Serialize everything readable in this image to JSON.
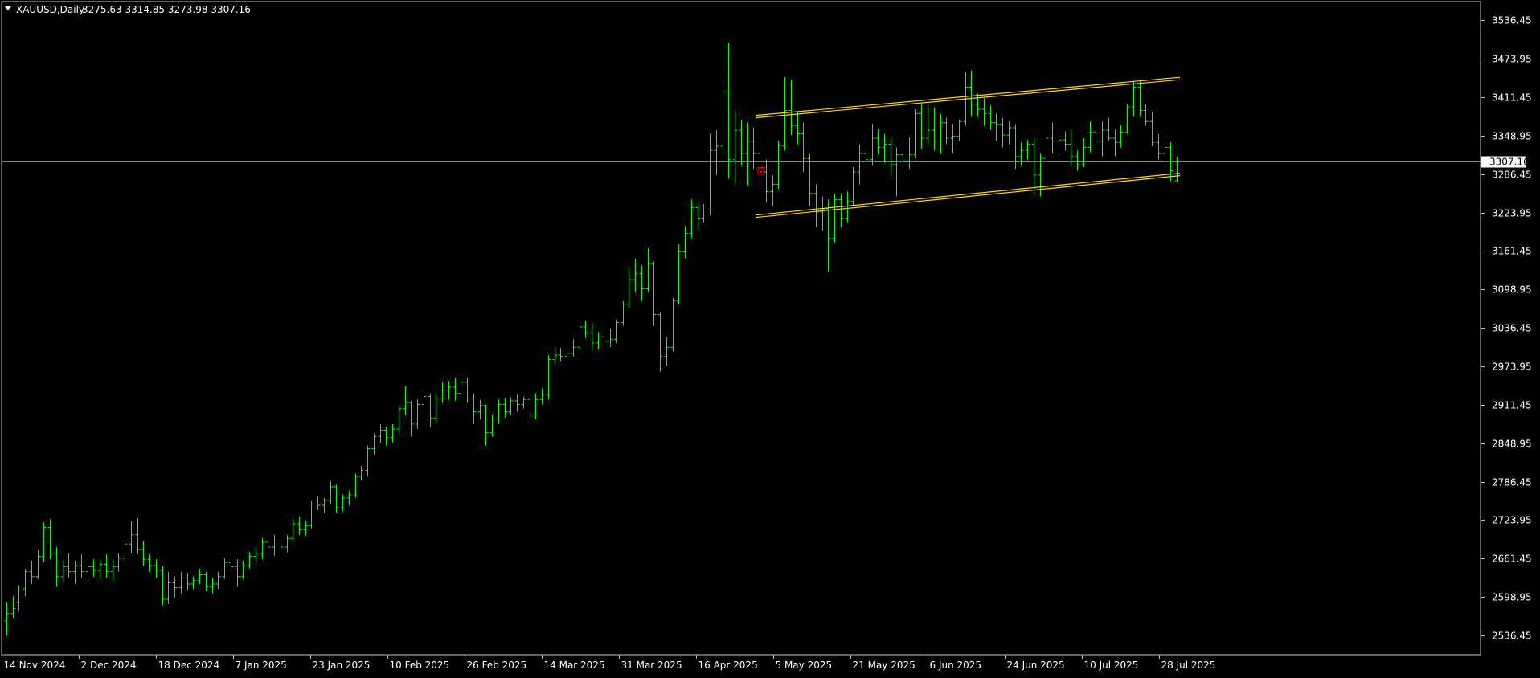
{
  "header": {
    "symbol_label": "XAUUSD,Daily",
    "ohlc_label": "3275.63 3314.85 3273.98 3307.16"
  },
  "colors": {
    "background": "#000000",
    "frame": "#c0c0c0",
    "axis_text": "#ffffff",
    "bar": "#00ff00",
    "channel": "#ffd700",
    "price_line": "#778899",
    "arrow_marker": "#ff0000",
    "price_tag_bg": "#ffffff",
    "price_tag_text": "#000000"
  },
  "icons": {
    "symbol_dropdown": "triangle-down-icon",
    "entry_marker": "arrow-marker-icon"
  },
  "chart_data": {
    "type": "ohlc",
    "title": "XAUUSD,Daily",
    "current_price": 3307.16,
    "current_price_label": "3307.16",
    "ylim": [
      2505.0,
      3567.0
    ],
    "y_ticks": [
      "3536.45",
      "3473.95",
      "3411.45",
      "3348.95",
      "3286.45",
      "3223.95",
      "3161.45",
      "3098.95",
      "3036.45",
      "2973.95",
      "2911.45",
      "2848.95",
      "2786.45",
      "2723.95",
      "2661.45",
      "2598.95",
      "2536.45"
    ],
    "x_ticks": [
      "14 Nov 2024",
      "2 Dec 2024",
      "18 Dec 2024",
      "7 Jan 2025",
      "23 Jan 2025",
      "10 Feb 2025",
      "26 Feb 2025",
      "14 Mar 2025",
      "31 Mar 2025",
      "16 Apr 2025",
      "5 May 2025",
      "21 May 2025",
      "6 Jun 2025",
      "24 Jun 2025",
      "10 Jul 2025",
      "28 Jul 2025"
    ],
    "channel_start": "22 Apr 2025",
    "channel_end": "29 Jul 2025",
    "channel_upper": [
      3380,
      3442
    ],
    "channel_lower": [
      3218,
      3286
    ],
    "marker_price": 3292,
    "bars": [
      {
        "o": 2560,
        "h": 2590,
        "l": 2536,
        "c": 2572
      },
      {
        "o": 2572,
        "h": 2600,
        "l": 2565,
        "c": 2580
      },
      {
        "o": 2590,
        "h": 2618,
        "l": 2575,
        "c": 2610
      },
      {
        "o": 2612,
        "h": 2645,
        "l": 2600,
        "c": 2640
      },
      {
        "o": 2640,
        "h": 2658,
        "l": 2620,
        "c": 2632
      },
      {
        "o": 2632,
        "h": 2675,
        "l": 2628,
        "c": 2665
      },
      {
        "o": 2665,
        "h": 2720,
        "l": 2655,
        "c": 2712
      },
      {
        "o": 2712,
        "h": 2725,
        "l": 2660,
        "c": 2670
      },
      {
        "o": 2670,
        "h": 2680,
        "l": 2615,
        "c": 2632
      },
      {
        "o": 2632,
        "h": 2660,
        "l": 2622,
        "c": 2648
      },
      {
        "o": 2648,
        "h": 2670,
        "l": 2630,
        "c": 2640
      },
      {
        "o": 2640,
        "h": 2658,
        "l": 2620,
        "c": 2650
      },
      {
        "o": 2650,
        "h": 2668,
        "l": 2630,
        "c": 2640
      },
      {
        "o": 2640,
        "h": 2655,
        "l": 2625,
        "c": 2648
      },
      {
        "o": 2648,
        "h": 2660,
        "l": 2632,
        "c": 2642
      },
      {
        "o": 2642,
        "h": 2660,
        "l": 2628,
        "c": 2652
      },
      {
        "o": 2652,
        "h": 2668,
        "l": 2630,
        "c": 2640
      },
      {
        "o": 2640,
        "h": 2660,
        "l": 2625,
        "c": 2648
      },
      {
        "o": 2648,
        "h": 2670,
        "l": 2640,
        "c": 2662
      },
      {
        "o": 2662,
        "h": 2690,
        "l": 2655,
        "c": 2685
      },
      {
        "o": 2685,
        "h": 2722,
        "l": 2670,
        "c": 2700
      },
      {
        "o": 2700,
        "h": 2727,
        "l": 2668,
        "c": 2676
      },
      {
        "o": 2676,
        "h": 2690,
        "l": 2650,
        "c": 2660
      },
      {
        "o": 2660,
        "h": 2668,
        "l": 2640,
        "c": 2650
      },
      {
        "o": 2650,
        "h": 2660,
        "l": 2630,
        "c": 2642
      },
      {
        "o": 2642,
        "h": 2650,
        "l": 2585,
        "c": 2595
      },
      {
        "o": 2595,
        "h": 2640,
        "l": 2588,
        "c": 2622
      },
      {
        "o": 2622,
        "h": 2632,
        "l": 2598,
        "c": 2614
      },
      {
        "o": 2614,
        "h": 2640,
        "l": 2605,
        "c": 2630
      },
      {
        "o": 2630,
        "h": 2638,
        "l": 2610,
        "c": 2620
      },
      {
        "o": 2620,
        "h": 2632,
        "l": 2612,
        "c": 2626
      },
      {
        "o": 2626,
        "h": 2645,
        "l": 2620,
        "c": 2635
      },
      {
        "o": 2635,
        "h": 2640,
        "l": 2608,
        "c": 2615
      },
      {
        "o": 2615,
        "h": 2630,
        "l": 2605,
        "c": 2620
      },
      {
        "o": 2620,
        "h": 2640,
        "l": 2612,
        "c": 2632
      },
      {
        "o": 2632,
        "h": 2662,
        "l": 2628,
        "c": 2655
      },
      {
        "o": 2655,
        "h": 2668,
        "l": 2640,
        "c": 2648
      },
      {
        "o": 2648,
        "h": 2660,
        "l": 2615,
        "c": 2632
      },
      {
        "o": 2632,
        "h": 2658,
        "l": 2628,
        "c": 2650
      },
      {
        "o": 2650,
        "h": 2672,
        "l": 2645,
        "c": 2665
      },
      {
        "o": 2665,
        "h": 2680,
        "l": 2656,
        "c": 2670
      },
      {
        "o": 2670,
        "h": 2695,
        "l": 2660,
        "c": 2688
      },
      {
        "o": 2688,
        "h": 2700,
        "l": 2670,
        "c": 2680
      },
      {
        "o": 2680,
        "h": 2700,
        "l": 2666,
        "c": 2690
      },
      {
        "o": 2690,
        "h": 2705,
        "l": 2675,
        "c": 2680
      },
      {
        "o": 2680,
        "h": 2700,
        "l": 2672,
        "c": 2694
      },
      {
        "o": 2694,
        "h": 2726,
        "l": 2690,
        "c": 2718
      },
      {
        "o": 2718,
        "h": 2730,
        "l": 2700,
        "c": 2708
      },
      {
        "o": 2708,
        "h": 2724,
        "l": 2698,
        "c": 2715
      },
      {
        "o": 2715,
        "h": 2755,
        "l": 2710,
        "c": 2750
      },
      {
        "o": 2750,
        "h": 2762,
        "l": 2740,
        "c": 2748
      },
      {
        "o": 2748,
        "h": 2760,
        "l": 2735,
        "c": 2756
      },
      {
        "o": 2756,
        "h": 2787,
        "l": 2750,
        "c": 2778
      },
      {
        "o": 2778,
        "h": 2782,
        "l": 2736,
        "c": 2744
      },
      {
        "o": 2744,
        "h": 2766,
        "l": 2738,
        "c": 2760
      },
      {
        "o": 2760,
        "h": 2772,
        "l": 2748,
        "c": 2765
      },
      {
        "o": 2765,
        "h": 2800,
        "l": 2760,
        "c": 2795
      },
      {
        "o": 2795,
        "h": 2812,
        "l": 2788,
        "c": 2805
      },
      {
        "o": 2805,
        "h": 2845,
        "l": 2795,
        "c": 2840
      },
      {
        "o": 2840,
        "h": 2865,
        "l": 2830,
        "c": 2860
      },
      {
        "o": 2860,
        "h": 2880,
        "l": 2848,
        "c": 2870
      },
      {
        "o": 2870,
        "h": 2876,
        "l": 2845,
        "c": 2858
      },
      {
        "o": 2858,
        "h": 2880,
        "l": 2850,
        "c": 2872
      },
      {
        "o": 2872,
        "h": 2910,
        "l": 2865,
        "c": 2905
      },
      {
        "o": 2905,
        "h": 2942,
        "l": 2895,
        "c": 2915
      },
      {
        "o": 2915,
        "h": 2918,
        "l": 2860,
        "c": 2880
      },
      {
        "o": 2880,
        "h": 2920,
        "l": 2872,
        "c": 2912
      },
      {
        "o": 2912,
        "h": 2935,
        "l": 2900,
        "c": 2925
      },
      {
        "o": 2925,
        "h": 2930,
        "l": 2875,
        "c": 2890
      },
      {
        "o": 2890,
        "h": 2930,
        "l": 2882,
        "c": 2922
      },
      {
        "o": 2922,
        "h": 2948,
        "l": 2915,
        "c": 2935
      },
      {
        "o": 2935,
        "h": 2950,
        "l": 2920,
        "c": 2940
      },
      {
        "o": 2940,
        "h": 2955,
        "l": 2918,
        "c": 2930
      },
      {
        "o": 2930,
        "h": 2955,
        "l": 2922,
        "c": 2948
      },
      {
        "o": 2948,
        "h": 2956,
        "l": 2915,
        "c": 2922
      },
      {
        "o": 2922,
        "h": 2930,
        "l": 2880,
        "c": 2900
      },
      {
        "o": 2900,
        "h": 2920,
        "l": 2888,
        "c": 2910
      },
      {
        "o": 2910,
        "h": 2912,
        "l": 2845,
        "c": 2866
      },
      {
        "o": 2866,
        "h": 2895,
        "l": 2860,
        "c": 2888
      },
      {
        "o": 2888,
        "h": 2920,
        "l": 2880,
        "c": 2912
      },
      {
        "o": 2912,
        "h": 2922,
        "l": 2890,
        "c": 2900
      },
      {
        "o": 2900,
        "h": 2924,
        "l": 2895,
        "c": 2918
      },
      {
        "o": 2918,
        "h": 2928,
        "l": 2900,
        "c": 2912
      },
      {
        "o": 2912,
        "h": 2925,
        "l": 2905,
        "c": 2920
      },
      {
        "o": 2920,
        "h": 2922,
        "l": 2882,
        "c": 2895
      },
      {
        "o": 2895,
        "h": 2930,
        "l": 2888,
        "c": 2920
      },
      {
        "o": 2920,
        "h": 2938,
        "l": 2912,
        "c": 2928
      },
      {
        "o": 2928,
        "h": 2992,
        "l": 2920,
        "c": 2985
      },
      {
        "o": 2985,
        "h": 3005,
        "l": 2978,
        "c": 2992
      },
      {
        "o": 2992,
        "h": 3004,
        "l": 2982,
        "c": 2990
      },
      {
        "o": 2990,
        "h": 3002,
        "l": 2985,
        "c": 2995
      },
      {
        "o": 2995,
        "h": 3018,
        "l": 2990,
        "c": 3005
      },
      {
        "o": 3005,
        "h": 3045,
        "l": 2998,
        "c": 3038
      },
      {
        "o": 3038,
        "h": 3048,
        "l": 3020,
        "c": 3028
      },
      {
        "o": 3028,
        "h": 3045,
        "l": 3000,
        "c": 3012
      },
      {
        "o": 3012,
        "h": 3030,
        "l": 3002,
        "c": 3022
      },
      {
        "o": 3022,
        "h": 3026,
        "l": 3008,
        "c": 3015
      },
      {
        "o": 3015,
        "h": 3035,
        "l": 3005,
        "c": 3018
      },
      {
        "o": 3018,
        "h": 3050,
        "l": 3012,
        "c": 3045
      },
      {
        "o": 3045,
        "h": 3080,
        "l": 3040,
        "c": 3075
      },
      {
        "o": 3075,
        "h": 3135,
        "l": 3068,
        "c": 3115
      },
      {
        "o": 3115,
        "h": 3148,
        "l": 3095,
        "c": 3125
      },
      {
        "o": 3125,
        "h": 3138,
        "l": 3080,
        "c": 3100
      },
      {
        "o": 3100,
        "h": 3166,
        "l": 3095,
        "c": 3140
      },
      {
        "o": 3140,
        "h": 3145,
        "l": 3040,
        "c": 3058
      },
      {
        "o": 3058,
        "h": 3062,
        "l": 2965,
        "c": 2990
      },
      {
        "o": 2990,
        "h": 3022,
        "l": 2975,
        "c": 3005
      },
      {
        "o": 3005,
        "h": 3085,
        "l": 2998,
        "c": 3080
      },
      {
        "o": 3080,
        "h": 3172,
        "l": 3075,
        "c": 3160
      },
      {
        "o": 3160,
        "h": 3202,
        "l": 3150,
        "c": 3190
      },
      {
        "o": 3190,
        "h": 3245,
        "l": 3182,
        "c": 3232
      },
      {
        "o": 3232,
        "h": 3240,
        "l": 3196,
        "c": 3215
      },
      {
        "o": 3215,
        "h": 3238,
        "l": 3208,
        "c": 3228
      },
      {
        "o": 3228,
        "h": 3352,
        "l": 3220,
        "c": 3325
      },
      {
        "o": 3325,
        "h": 3358,
        "l": 3285,
        "c": 3332
      },
      {
        "o": 3332,
        "h": 3440,
        "l": 3320,
        "c": 3420
      },
      {
        "o": 3420,
        "h": 3500,
        "l": 3280,
        "c": 3310
      },
      {
        "o": 3310,
        "h": 3390,
        "l": 3270,
        "c": 3358
      },
      {
        "o": 3358,
        "h": 3375,
        "l": 3300,
        "c": 3320
      },
      {
        "o": 3320,
        "h": 3370,
        "l": 3268,
        "c": 3340
      },
      {
        "o": 3340,
        "h": 3362,
        "l": 3295,
        "c": 3320
      },
      {
        "o": 3320,
        "h": 3335,
        "l": 3275,
        "c": 3290
      },
      {
        "o": 3290,
        "h": 3310,
        "l": 3240,
        "c": 3258
      },
      {
        "o": 3258,
        "h": 3285,
        "l": 3235,
        "c": 3270
      },
      {
        "o": 3270,
        "h": 3340,
        "l": 3262,
        "c": 3332
      },
      {
        "o": 3332,
        "h": 3444,
        "l": 3325,
        "c": 3390
      },
      {
        "o": 3390,
        "h": 3440,
        "l": 3350,
        "c": 3365
      },
      {
        "o": 3365,
        "h": 3388,
        "l": 3335,
        "c": 3352
      },
      {
        "o": 3352,
        "h": 3370,
        "l": 3290,
        "c": 3312
      },
      {
        "o": 3312,
        "h": 3320,
        "l": 3235,
        "c": 3255
      },
      {
        "o": 3255,
        "h": 3270,
        "l": 3200,
        "c": 3225
      },
      {
        "o": 3225,
        "h": 3250,
        "l": 3195,
        "c": 3230
      },
      {
        "o": 3230,
        "h": 3245,
        "l": 3128,
        "c": 3182
      },
      {
        "o": 3182,
        "h": 3255,
        "l": 3175,
        "c": 3245
      },
      {
        "o": 3245,
        "h": 3255,
        "l": 3200,
        "c": 3215
      },
      {
        "o": 3215,
        "h": 3258,
        "l": 3208,
        "c": 3242
      },
      {
        "o": 3242,
        "h": 3298,
        "l": 3235,
        "c": 3290
      },
      {
        "o": 3290,
        "h": 3335,
        "l": 3270,
        "c": 3320
      },
      {
        "o": 3320,
        "h": 3345,
        "l": 3290,
        "c": 3310
      },
      {
        "o": 3310,
        "h": 3368,
        "l": 3300,
        "c": 3345
      },
      {
        "o": 3345,
        "h": 3360,
        "l": 3318,
        "c": 3330
      },
      {
        "o": 3330,
        "h": 3352,
        "l": 3305,
        "c": 3335
      },
      {
        "o": 3335,
        "h": 3345,
        "l": 3285,
        "c": 3302
      },
      {
        "o": 3302,
        "h": 3330,
        "l": 3250,
        "c": 3318
      },
      {
        "o": 3318,
        "h": 3338,
        "l": 3290,
        "c": 3308
      },
      {
        "o": 3308,
        "h": 3346,
        "l": 3295,
        "c": 3318
      },
      {
        "o": 3318,
        "h": 3392,
        "l": 3312,
        "c": 3385
      },
      {
        "o": 3385,
        "h": 3403,
        "l": 3328,
        "c": 3345
      },
      {
        "o": 3345,
        "h": 3400,
        "l": 3335,
        "c": 3358
      },
      {
        "o": 3358,
        "h": 3395,
        "l": 3325,
        "c": 3340
      },
      {
        "o": 3340,
        "h": 3385,
        "l": 3320,
        "c": 3370
      },
      {
        "o": 3370,
        "h": 3378,
        "l": 3335,
        "c": 3345
      },
      {
        "o": 3345,
        "h": 3368,
        "l": 3320,
        "c": 3348
      },
      {
        "o": 3348,
        "h": 3375,
        "l": 3340,
        "c": 3372
      },
      {
        "o": 3372,
        "h": 3452,
        "l": 3365,
        "c": 3428
      },
      {
        "o": 3428,
        "h": 3455,
        "l": 3380,
        "c": 3400
      },
      {
        "o": 3400,
        "h": 3418,
        "l": 3380,
        "c": 3392
      },
      {
        "o": 3392,
        "h": 3410,
        "l": 3365,
        "c": 3385
      },
      {
        "o": 3385,
        "h": 3398,
        "l": 3358,
        "c": 3370
      },
      {
        "o": 3370,
        "h": 3385,
        "l": 3340,
        "c": 3368
      },
      {
        "o": 3368,
        "h": 3378,
        "l": 3330,
        "c": 3350
      },
      {
        "o": 3350,
        "h": 3372,
        "l": 3335,
        "c": 3362
      },
      {
        "o": 3362,
        "h": 3368,
        "l": 3295,
        "c": 3315
      },
      {
        "o": 3315,
        "h": 3338,
        "l": 3300,
        "c": 3325
      },
      {
        "o": 3325,
        "h": 3342,
        "l": 3310,
        "c": 3335
      },
      {
        "o": 3335,
        "h": 3345,
        "l": 3255,
        "c": 3285
      },
      {
        "o": 3285,
        "h": 3320,
        "l": 3250,
        "c": 3312
      },
      {
        "o": 3312,
        "h": 3358,
        "l": 3305,
        "c": 3345
      },
      {
        "o": 3345,
        "h": 3370,
        "l": 3320,
        "c": 3340
      },
      {
        "o": 3340,
        "h": 3368,
        "l": 3318,
        "c": 3342
      },
      {
        "o": 3342,
        "h": 3356,
        "l": 3325,
        "c": 3335
      },
      {
        "o": 3335,
        "h": 3358,
        "l": 3300,
        "c": 3315
      },
      {
        "o": 3315,
        "h": 3325,
        "l": 3292,
        "c": 3302
      },
      {
        "o": 3302,
        "h": 3345,
        "l": 3298,
        "c": 3330
      },
      {
        "o": 3330,
        "h": 3372,
        "l": 3322,
        "c": 3355
      },
      {
        "o": 3355,
        "h": 3375,
        "l": 3325,
        "c": 3340
      },
      {
        "o": 3340,
        "h": 3372,
        "l": 3315,
        "c": 3358
      },
      {
        "o": 3358,
        "h": 3378,
        "l": 3340,
        "c": 3345
      },
      {
        "o": 3345,
        "h": 3360,
        "l": 3315,
        "c": 3338
      },
      {
        "o": 3338,
        "h": 3366,
        "l": 3330,
        "c": 3355
      },
      {
        "o": 3355,
        "h": 3400,
        "l": 3352,
        "c": 3396
      },
      {
        "o": 3396,
        "h": 3438,
        "l": 3380,
        "c": 3428
      },
      {
        "o": 3428,
        "h": 3440,
        "l": 3380,
        "c": 3390
      },
      {
        "o": 3390,
        "h": 3400,
        "l": 3365,
        "c": 3372
      },
      {
        "o": 3372,
        "h": 3388,
        "l": 3332,
        "c": 3338
      },
      {
        "o": 3338,
        "h": 3352,
        "l": 3310,
        "c": 3320
      },
      {
        "o": 3320,
        "h": 3342,
        "l": 3305,
        "c": 3330
      },
      {
        "o": 3330,
        "h": 3338,
        "l": 3275,
        "c": 3292
      },
      {
        "o": 3275.63,
        "h": 3314.85,
        "l": 3273.98,
        "c": 3307.16
      }
    ]
  }
}
